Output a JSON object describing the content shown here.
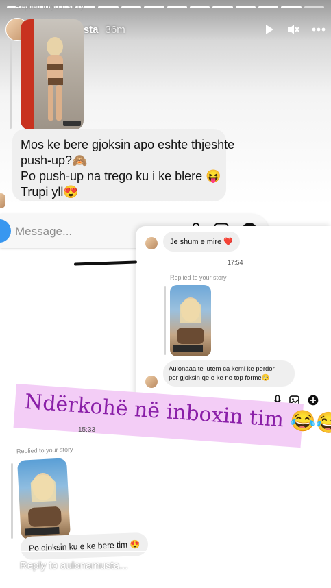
{
  "story": {
    "username": "aulonamusta",
    "time_ago": "36m",
    "progress_segments": 14,
    "progress_done": 13
  },
  "screenshot_top": {
    "replied_label": "Replied to your story",
    "message_lines": [
      "Mos ke bere gjoksin apo eshte thjeshte",
      "push-up?🙈",
      "Po push-up na trego ku i ke blere 😝",
      "Trupi yll😍"
    ],
    "composer_placeholder": "Message..."
  },
  "screenshot_overlay": {
    "message1": "Je shum e mire ❤️",
    "time": "17:54",
    "replied_label": "Replied to your story",
    "message2_line1": "Aulonaaa te lutem ca kemi ke perdor",
    "message2_line2": "per gjoksin qe e ke ne top forme🥺"
  },
  "banner_text": "Ndërkohë në inboxin tim 😂😂😂",
  "screenshot_bottom": {
    "time": "15:33",
    "replied_label": "Replied to your story",
    "message": "Po gjoksin ku e ke bere tim 😍"
  },
  "footer": {
    "reply_placeholder": "Reply to aulonamusta..."
  },
  "icons": {
    "play": "play-icon",
    "mute": "mute-icon",
    "more": "more-icon",
    "mic": "mic-icon",
    "gallery": "gallery-icon",
    "add": "add-icon",
    "like": "heart-icon",
    "send": "send-icon"
  },
  "colors": {
    "banner_bg": "#f3cdf6",
    "banner_text": "#8a1fa8",
    "composer_camera": "#3897f0"
  }
}
